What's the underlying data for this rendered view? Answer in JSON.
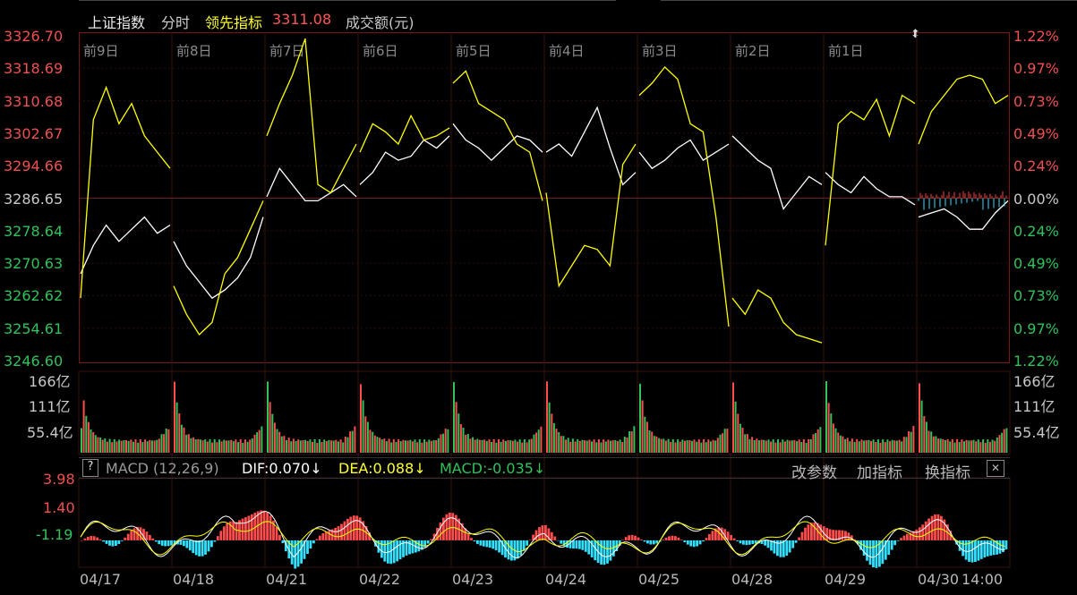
{
  "header": {
    "index_name": "上证指数",
    "mode": "分时",
    "leading_label": "领先指标",
    "leading_value": "3311.08",
    "volume_label": "成交额(元)"
  },
  "price_axis": [
    "3326.70",
    "3318.69",
    "3310.68",
    "3302.67",
    "3294.66",
    "3286.65",
    "3278.64",
    "3270.63",
    "3262.62",
    "3254.61",
    "3246.60"
  ],
  "pct_axis": [
    "1.22%",
    "0.97%",
    "0.73%",
    "0.49%",
    "0.24%",
    "0.00%",
    "0.24%",
    "0.49%",
    "0.73%",
    "0.97%",
    "1.22%"
  ],
  "day_labels": [
    "前9日",
    "前8日",
    "前7日",
    "前6日",
    "前5日",
    "前4日",
    "前3日",
    "前2日",
    "前1日"
  ],
  "volume_axis": [
    "166亿",
    "111亿",
    "55.4亿"
  ],
  "macd": {
    "help": "?",
    "name": "MACD (12,26,9)",
    "dif": "DIF:0.070↓",
    "dea": "DEA:0.088↓",
    "macd": "MACD:-0.035↓",
    "btn_params": "改参数",
    "btn_add": "加指标",
    "btn_switch": "换指标",
    "close": "✕",
    "axis": [
      "3.98",
      "1.40",
      "-1.19"
    ]
  },
  "date_labels": [
    "04/17",
    "04/18",
    "04/21",
    "04/22",
    "04/23",
    "04/24",
    "04/25",
    "04/28",
    "04/29",
    "04/30",
    "14:00"
  ],
  "chart_data": {
    "type": "line",
    "title": "上证指数 分时",
    "ylim": [
      3246.6,
      3326.7
    ],
    "prev_close": 3286.65,
    "days": [
      "04/17",
      "04/18",
      "04/21",
      "04/22",
      "04/23",
      "04/24",
      "04/25",
      "04/28",
      "04/29",
      "04/30"
    ],
    "series": [
      {
        "name": "上证指数",
        "color": "#ffffff",
        "values": [
          3268,
          3275,
          3280,
          3276,
          3279,
          3282,
          3278,
          3280,
          3276,
          3270,
          3266,
          3262,
          3264,
          3267,
          3272,
          3282,
          3287,
          3294,
          3290,
          3286,
          3286,
          3288,
          3290,
          3287,
          3290,
          3293,
          3298,
          3296,
          3297,
          3301,
          3299,
          3302,
          3305,
          3301,
          3299,
          3296,
          3299,
          3302,
          3301,
          3298,
          3298,
          3300,
          3297,
          3303,
          3309,
          3299,
          3290,
          3293,
          3298,
          3294,
          3296,
          3299,
          3301,
          3296,
          3298,
          3300,
          3302,
          3299,
          3296,
          3294,
          3284,
          3288,
          3292,
          3290,
          3293,
          3290,
          3288,
          3292,
          3289,
          3287,
          3287,
          3285,
          3282,
          3283,
          3284,
          3282,
          3279,
          3279,
          3283,
          3286
        ]
      },
      {
        "name": "领先指标",
        "color": "#ffff00",
        "values": [
          3262,
          3306,
          3314,
          3305,
          3310,
          3302,
          3298,
          3294,
          3265,
          3258,
          3253,
          3256,
          3268,
          3272,
          3279,
          3286,
          3302,
          3310,
          3317,
          3326,
          3290,
          3288,
          3294,
          3300,
          3298,
          3305,
          3303,
          3300,
          3307,
          3301,
          3302,
          3304,
          3315,
          3318,
          3310,
          3308,
          3306,
          3300,
          3298,
          3286,
          3288,
          3265,
          3270,
          3275,
          3274,
          3270,
          3295,
          3300,
          3312,
          3315,
          3319,
          3316,
          3305,
          3303,
          3282,
          3255,
          3262,
          3258,
          3264,
          3262,
          3256,
          3253,
          3252,
          3251,
          3275,
          3305,
          3308,
          3306,
          3311,
          3302,
          3312,
          3310,
          3300,
          3308,
          3312,
          3316,
          3317,
          3316,
          3310,
          3312
        ]
      }
    ],
    "volume_ylim": [
      0,
      166
    ],
    "volume_unit": "亿",
    "macd_ylim": [
      -1.19,
      3.98
    ]
  }
}
